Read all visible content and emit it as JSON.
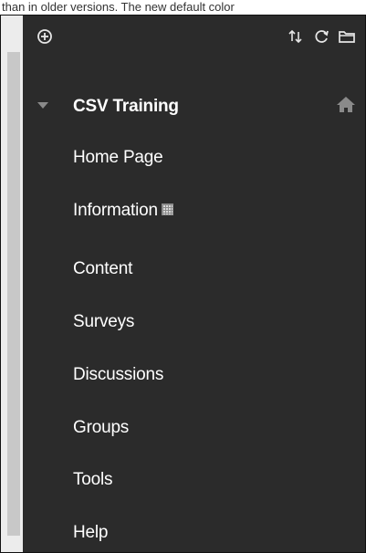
{
  "caption": "than in older versions. The new default color",
  "toolbar": {
    "icons": [
      {
        "name": "add-menu-item-icon"
      },
      {
        "name": "reorder-icon"
      },
      {
        "name": "refresh-icon"
      },
      {
        "name": "folder-icon"
      }
    ]
  },
  "course": {
    "title": "CSV Training",
    "home_icon": "home-icon"
  },
  "menu": {
    "items": [
      {
        "label": "Home Page"
      },
      {
        "label": "Information",
        "icon": "content-list-icon"
      },
      {
        "label": "Content"
      },
      {
        "label": "Surveys"
      },
      {
        "label": "Discussions"
      },
      {
        "label": "Groups"
      },
      {
        "label": "Tools"
      },
      {
        "label": "Help"
      }
    ]
  },
  "colors": {
    "menu_background": "#2b2b2b",
    "menu_text": "#ffffff",
    "icon_gray": "#8a8a8a"
  }
}
